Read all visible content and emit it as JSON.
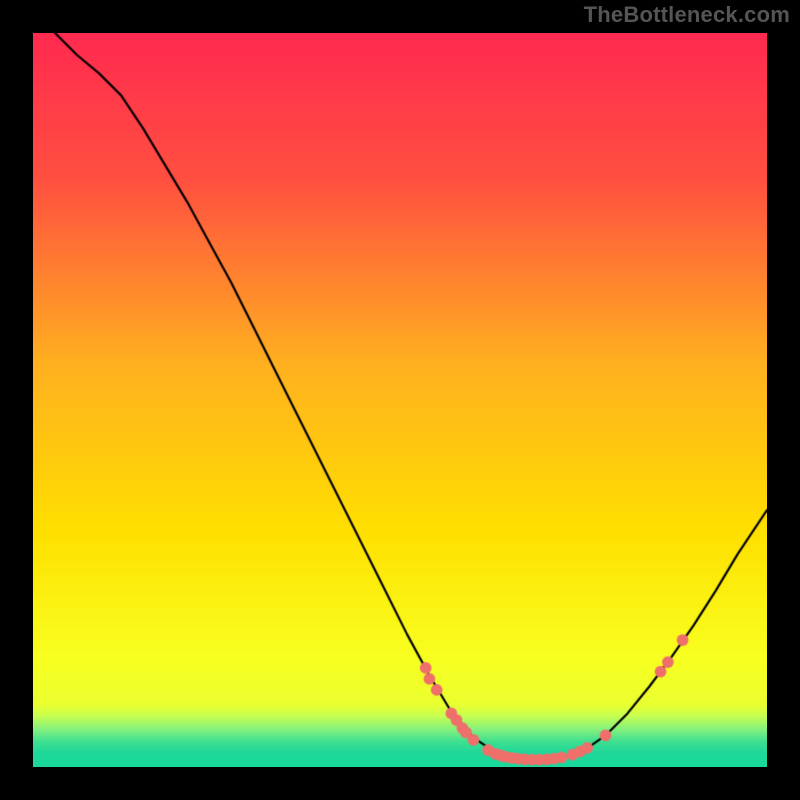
{
  "watermark": "TheBottleneck.com",
  "colors": {
    "background": "#000000",
    "curve": "#000000",
    "marker": "#ef6f6a",
    "gradient_stops": [
      {
        "pos": 0.0,
        "color": "#ff2a50"
      },
      {
        "pos": 0.2,
        "color": "#ff5040"
      },
      {
        "pos": 0.45,
        "color": "#ffb020"
      },
      {
        "pos": 0.68,
        "color": "#ffe000"
      },
      {
        "pos": 0.85,
        "color": "#f8ff20"
      },
      {
        "pos": 0.915,
        "color": "#eaff30"
      },
      {
        "pos": 0.93,
        "color": "#c8ff50"
      },
      {
        "pos": 0.95,
        "color": "#80f080"
      },
      {
        "pos": 0.965,
        "color": "#40e090"
      },
      {
        "pos": 0.98,
        "color": "#20d89a"
      },
      {
        "pos": 1.0,
        "color": "#18d89c"
      }
    ]
  },
  "chart_data": {
    "type": "line",
    "title": "",
    "xlabel": "",
    "ylabel": "",
    "xlim": [
      0,
      100
    ],
    "ylim": [
      0,
      100
    ],
    "grid": false,
    "series": [
      {
        "name": "bottleneck-curve",
        "x": [
          3,
          6,
          9,
          12,
          15,
          18,
          21,
          24,
          27,
          30,
          33,
          36,
          39,
          42,
          45,
          48,
          51,
          54,
          57,
          60,
          63,
          66,
          69,
          72,
          75,
          78,
          81,
          84,
          87,
          90,
          93,
          96,
          100
        ],
        "y": [
          100,
          97,
          94.5,
          91.5,
          87,
          82,
          77,
          71.5,
          66,
          60,
          54,
          48,
          42,
          36,
          30,
          24,
          18,
          12.5,
          7.5,
          4,
          2,
          1.2,
          1,
          1.3,
          2.2,
          4.3,
          7.3,
          11,
          15,
          19.3,
          24,
          29,
          35
        ]
      }
    ],
    "markers": [
      {
        "x": 53.5,
        "y": 13.5
      },
      {
        "x": 54.0,
        "y": 12.0
      },
      {
        "x": 55.0,
        "y": 10.5
      },
      {
        "x": 57.0,
        "y": 7.3
      },
      {
        "x": 57.7,
        "y": 6.4
      },
      {
        "x": 58.5,
        "y": 5.3
      },
      {
        "x": 59.0,
        "y": 4.7
      },
      {
        "x": 60.0,
        "y": 3.7
      },
      {
        "x": 62.0,
        "y": 2.3
      },
      {
        "x": 63.0,
        "y": 1.8
      },
      {
        "x": 63.7,
        "y": 1.6
      },
      {
        "x": 64.3,
        "y": 1.4
      },
      {
        "x": 65.2,
        "y": 1.25
      },
      {
        "x": 66.0,
        "y": 1.15
      },
      {
        "x": 67.0,
        "y": 1.05
      },
      {
        "x": 68.0,
        "y": 1.0
      },
      {
        "x": 69.0,
        "y": 1.0
      },
      {
        "x": 70.0,
        "y": 1.05
      },
      {
        "x": 71.0,
        "y": 1.15
      },
      {
        "x": 72.0,
        "y": 1.3
      },
      {
        "x": 73.5,
        "y": 1.7
      },
      {
        "x": 74.5,
        "y": 2.1
      },
      {
        "x": 75.5,
        "y": 2.6
      },
      {
        "x": 78.0,
        "y": 4.3
      },
      {
        "x": 85.5,
        "y": 13.0
      },
      {
        "x": 86.5,
        "y": 14.3
      },
      {
        "x": 88.5,
        "y": 17.3
      }
    ],
    "marker_radius_data_units": 0.8
  }
}
